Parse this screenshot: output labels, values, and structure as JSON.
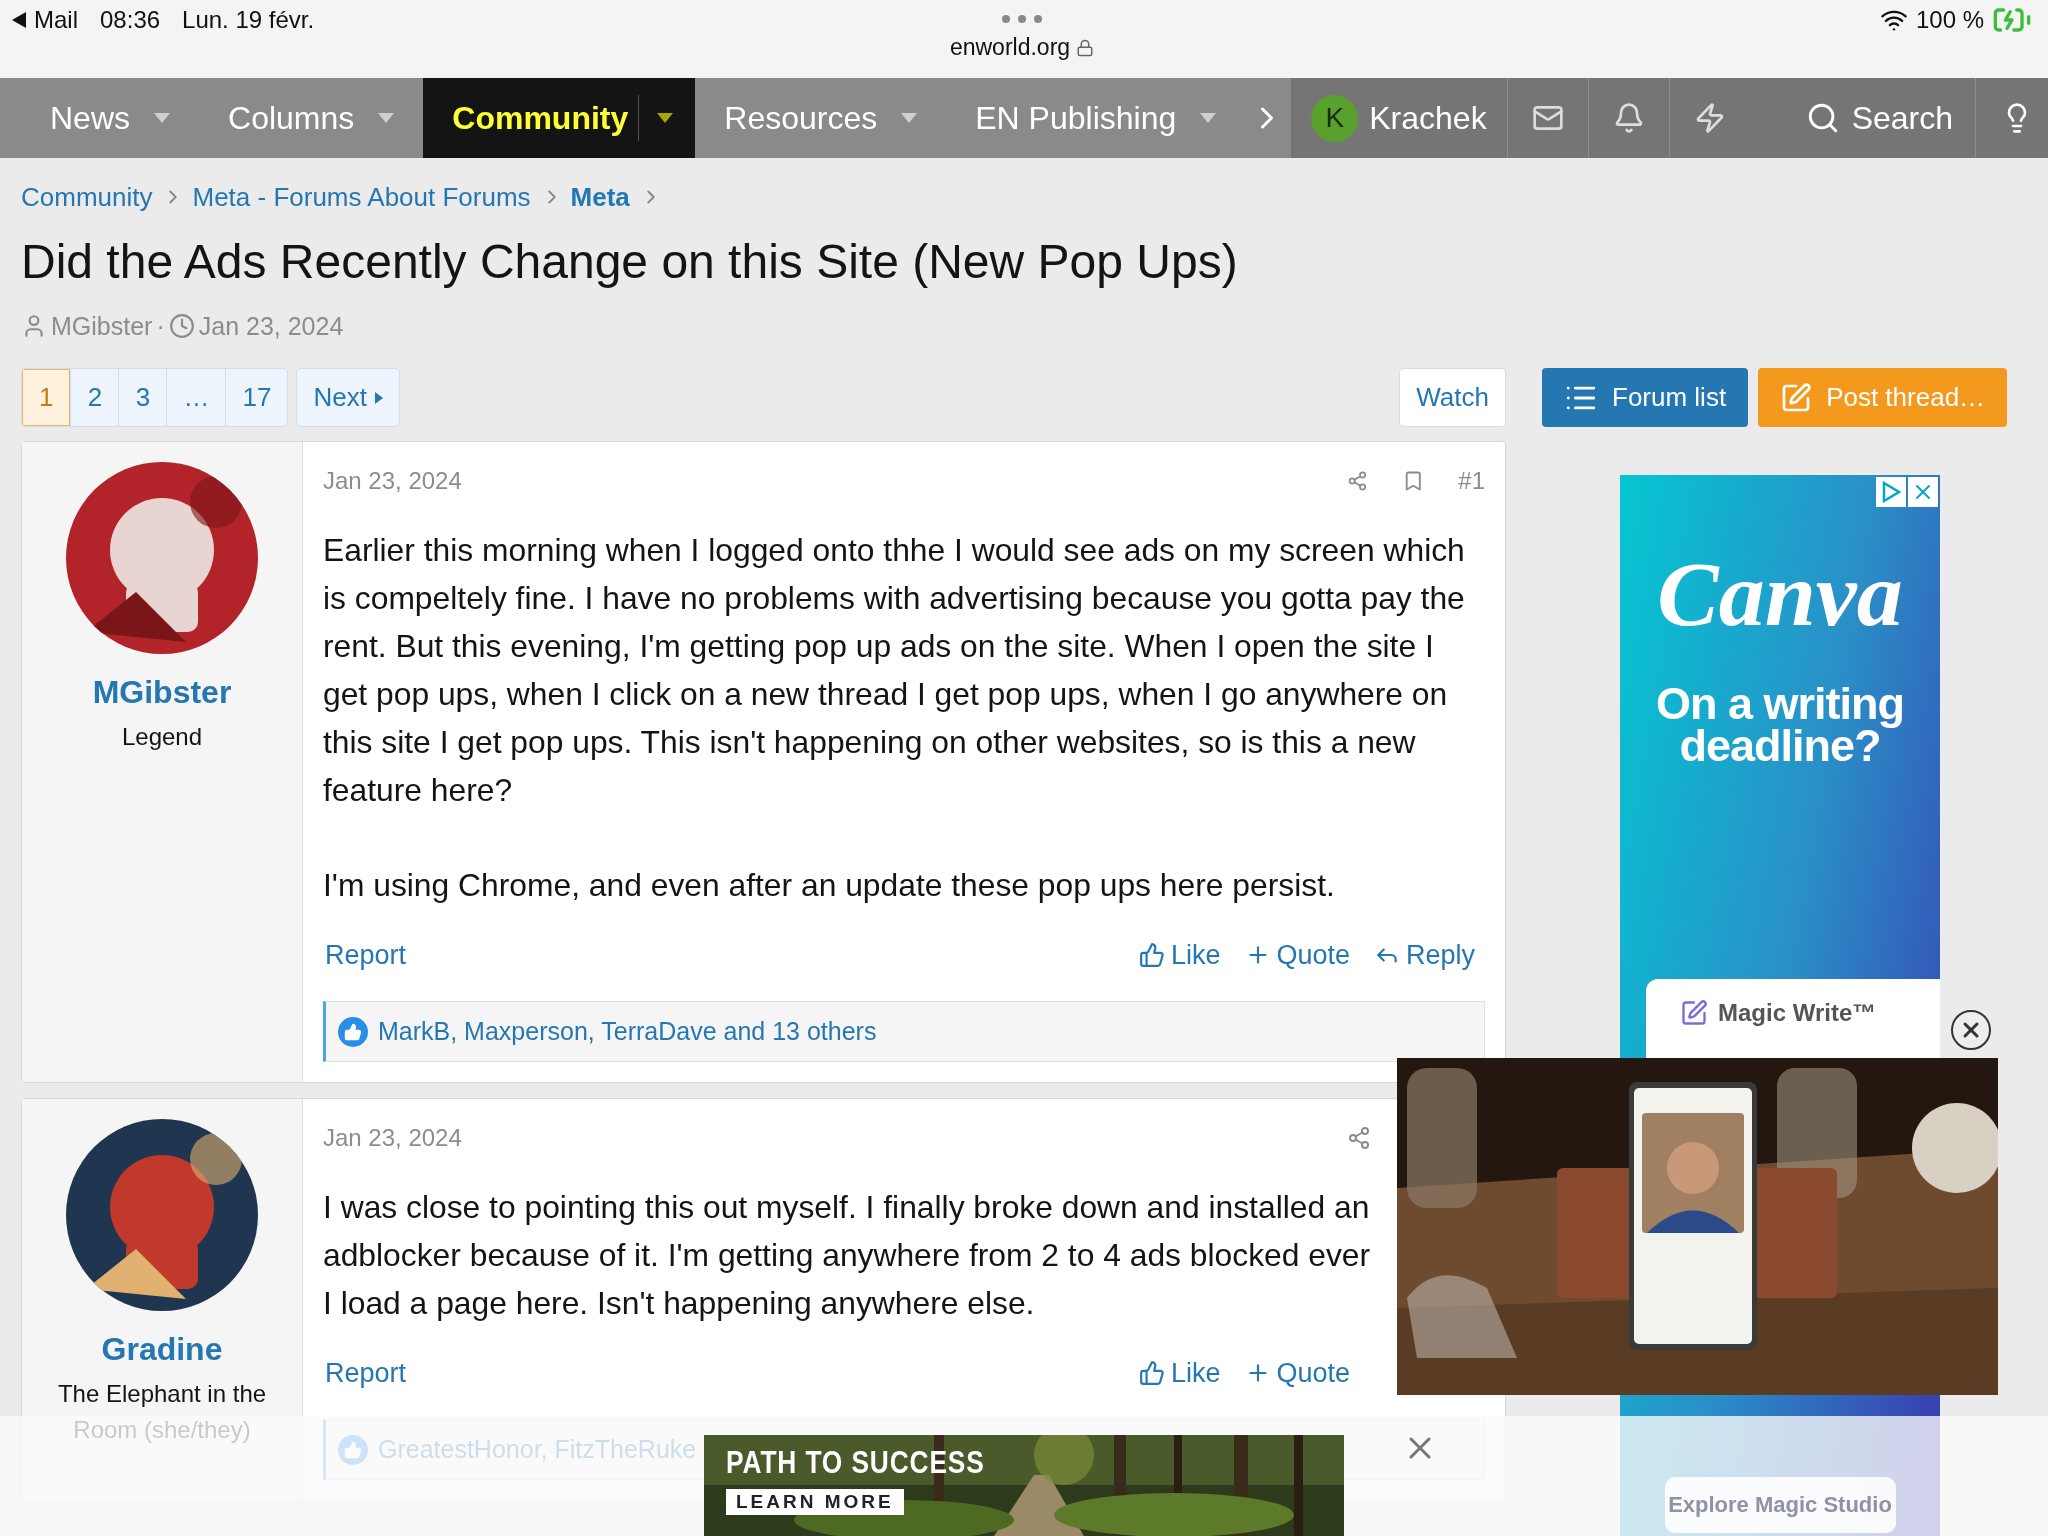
{
  "status_bar": {
    "back_app": "Mail",
    "time": "08:36",
    "date": "Lun. 19 févr.",
    "url": "enworld.org",
    "battery": "100 %"
  },
  "nav": {
    "items": [
      {
        "label": "News",
        "selected": false
      },
      {
        "label": "Columns",
        "selected": false
      },
      {
        "label": "Community",
        "selected": true
      },
      {
        "label": "Resources",
        "selected": false
      },
      {
        "label": "EN Publishing",
        "selected": false
      }
    ],
    "user": {
      "initial": "K",
      "name": "Krachek"
    },
    "search": "Search"
  },
  "breadcrumb": [
    {
      "label": "Community",
      "current": false
    },
    {
      "label": "Meta - Forums About Forums",
      "current": false
    },
    {
      "label": "Meta",
      "current": true
    }
  ],
  "thread": {
    "title": "Did the Ads Recently Change on this Site (New Pop Ups)",
    "author": "MGibster",
    "separator": "·",
    "date": "Jan 23, 2024"
  },
  "pagination": {
    "pages": [
      {
        "label": "1",
        "selected": true
      },
      {
        "label": "2",
        "selected": false
      },
      {
        "label": "3",
        "selected": false
      },
      {
        "label": "…",
        "selected": false
      },
      {
        "label": "17",
        "selected": false
      }
    ],
    "next": "Next"
  },
  "buttons": {
    "watch": "Watch",
    "forum_list": "Forum list",
    "post_thread": "Post thread…"
  },
  "posts": [
    {
      "user": {
        "name": "MGibster",
        "title": "Legend"
      },
      "date": "Jan 23, 2024",
      "number": "#1",
      "paragraphs": [
        [
          "Earlier this morning when I logged onto thhe I would see ads on my screen which is compeltely fine. I have no problems with advertising because you gotta pay the rent. But this evening, I'm getting pop up ads on the site. When I open the site I get pop ups, when I click on a new thread I get pop ups, when I go anywhere on this site I get pop ups. This isn't happening on other websites, so is this a new feature here?"
        ],
        [
          "I'm using Chrome, and even after an update these pop ups here persist."
        ]
      ],
      "report": "Report",
      "actions": [
        {
          "kind": "like",
          "label": "Like"
        },
        {
          "kind": "quote",
          "label": "Quote"
        },
        {
          "kind": "reply",
          "label": "Reply"
        }
      ],
      "reactions": "MarkB, Maxperson, TerraDave and 13 others"
    },
    {
      "user": {
        "name": "Gradine",
        "title": "The Elephant in the Room (she/they)"
      },
      "date": "Jan 23, 2024",
      "paragraphs": [
        [
          "I was close to pointing this out myself. I finally broke down and installed an",
          "adblocker because of it. I'm getting anywhere from 2 to 4 ads blocked ever",
          "I load a page here. Isn't happening anywhere else."
        ]
      ],
      "report": "Report",
      "actions": [
        {
          "kind": "like",
          "label": "Like"
        },
        {
          "kind": "quote",
          "label": "Quote"
        }
      ],
      "reactions": "GreatestHonor, FitzTheRuke"
    }
  ],
  "ads": {
    "sidebar": {
      "brand": "Canva",
      "headline": "On a writing deadline?",
      "feature": "Magic Write™",
      "cta": "Explore Magic Studio"
    },
    "banner": {
      "headline": "PATH TO SUCCESS",
      "cta": "LEARN MORE"
    }
  }
}
